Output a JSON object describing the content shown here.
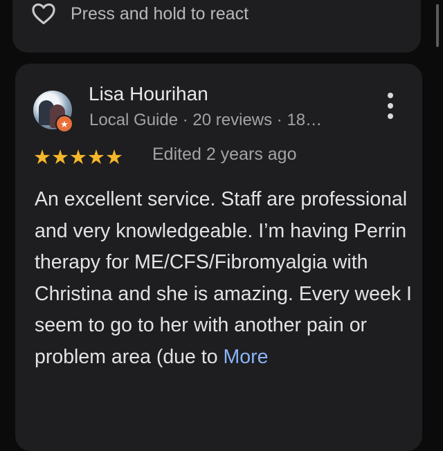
{
  "previous_review": {
    "react_label": "Press and hold to react",
    "icon": "heart-outline-icon"
  },
  "review": {
    "author": "Lisa Hourihan",
    "meta": "Local Guide · 20 reviews · 18…",
    "rating": 5,
    "rating_stars": "★★★★★",
    "edited": "Edited 2 years ago",
    "text": "An excellent service. Staff are professional and very knowledgeable. I’m having Perrin therapy for ME/CFS/Fibromyalgia with Christina and she is amazing. Every week I seem to go to her with another pain or problem area (due to",
    "more_label": "More",
    "avatar_icon": "profile-photo",
    "badge_icon": "local-guide-star-icon",
    "menu_icon": "more-vert-icon"
  },
  "colors": {
    "background": "#0b0b0c",
    "card": "#1e1e20",
    "star": "#f6b72b",
    "link": "#8ab4f8",
    "badge": "#e8703a"
  }
}
